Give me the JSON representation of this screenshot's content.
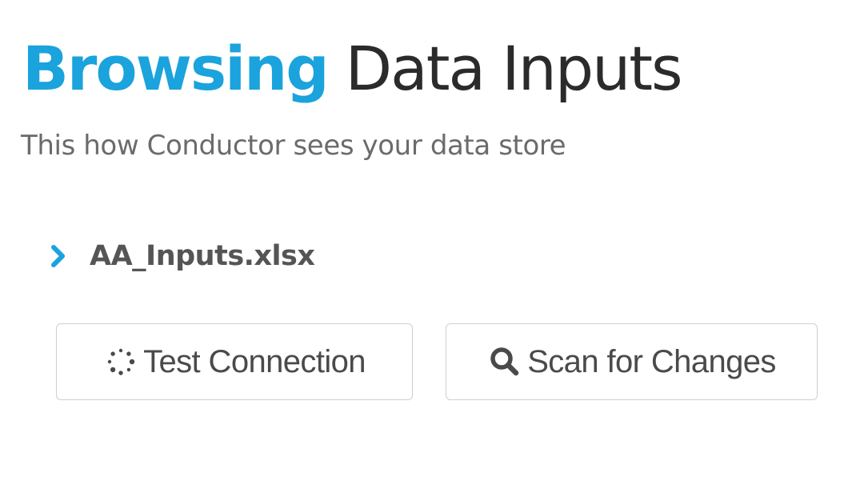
{
  "header": {
    "title_accent": "Browsing",
    "title_main": "Data Inputs",
    "subtitle": "This how Conductor sees your data store"
  },
  "tree": {
    "items": [
      {
        "label": "AA_Inputs.xlsx",
        "icon": "chevron-right-icon",
        "expanded": false
      }
    ]
  },
  "actions": {
    "test_connection": {
      "label": "Test Connection",
      "icon": "spinner-icon"
    },
    "scan_for_changes": {
      "label": "Scan for Changes",
      "icon": "search-icon"
    }
  },
  "colors": {
    "accent": "#1aa3dc",
    "text_dark": "#2b2b2b",
    "text_muted": "#6b6b6b",
    "border": "#cfcfcf"
  }
}
